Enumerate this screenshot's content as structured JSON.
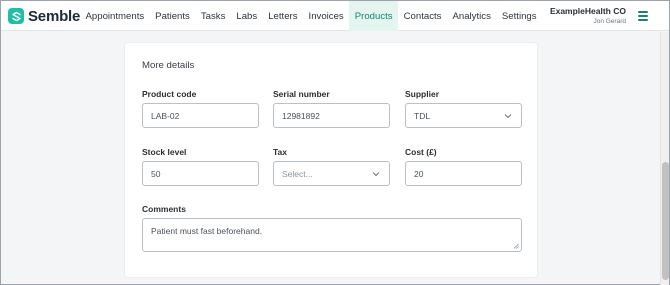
{
  "app": {
    "logo_text": "Semble",
    "logo_icon": "semble-logo-icon"
  },
  "nav": {
    "items": [
      {
        "label": "Appointments",
        "active": false
      },
      {
        "label": "Patients",
        "active": false
      },
      {
        "label": "Tasks",
        "active": false
      },
      {
        "label": "Labs",
        "active": false
      },
      {
        "label": "Letters",
        "active": false
      },
      {
        "label": "Invoices",
        "active": false
      },
      {
        "label": "Products",
        "active": true
      },
      {
        "label": "Contacts",
        "active": false
      },
      {
        "label": "Analytics",
        "active": false
      },
      {
        "label": "Settings",
        "active": false
      }
    ]
  },
  "account": {
    "org": "ExampleHealth CO",
    "user": "Jon Gerard",
    "menu_icon": "hamburger-menu-icon"
  },
  "form": {
    "section_title": "More details",
    "product_code": {
      "label": "Product code",
      "value": "LAB-02"
    },
    "serial_number": {
      "label": "Serial number",
      "value": "12981892"
    },
    "supplier": {
      "label": "Supplier",
      "value": "TDL"
    },
    "stock_level": {
      "label": "Stock level",
      "value": "50"
    },
    "tax": {
      "label": "Tax",
      "placeholder": "Select..."
    },
    "cost": {
      "label": "Cost (£)",
      "value": "20"
    },
    "comments": {
      "label": "Comments",
      "value": "Patient must fast beforehand."
    }
  },
  "colors": {
    "accent": "#16826f",
    "active_bg": "#e4f5f0",
    "logo": "#1fbfa5"
  }
}
